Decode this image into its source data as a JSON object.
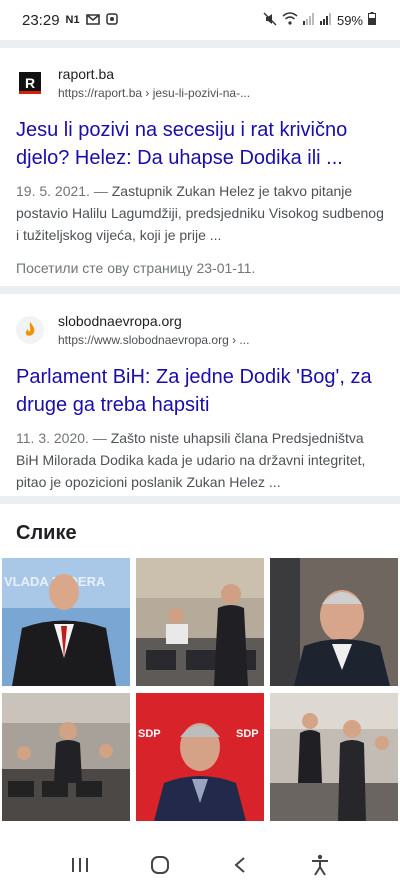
{
  "status_bar": {
    "time": "23:29",
    "left_icons": [
      "N1",
      "gmail-icon",
      "photo-icon"
    ],
    "battery": "59%",
    "right_icons": [
      "mute-icon",
      "wifi-icon",
      "signal-icon",
      "signal-icon",
      "battery-icon"
    ]
  },
  "results": [
    {
      "site_name": "raport.ba",
      "url": "https://raport.ba › jesu-li-pozivi-na-...",
      "title": "Jesu li pozivi na secesiju i rat krivično djelo? Helez: Da uhapse Dodika ili ...",
      "date": "19. 5. 2021. —",
      "snippet": " Zastupnik Zukan Helez je takvo pitanje postavio Halilu Lagumdžiji, predsjedniku Visokog sudbenog i tužiteljskog vijeća, koji je prije ...",
      "visited": "Посетили сте ову страницу 23-01-11.",
      "favicon_letter": "R"
    },
    {
      "site_name": "slobodnaevropa.org",
      "url": "https://www.slobodnaevropa.org › ...",
      "title": "Parlament BiH: Za jedne Dodik 'Bog', za druge ga treba hapsiti",
      "date": "11. 3. 2020. —",
      "snippet": " Zašto niste uhapsili člana Predsjedništva BiH Milorada Dodika kada je udario na državni integritet, pitao je opozicioni poslanik Zukan Helez ...",
      "favicon_icon": "rfe-flame-icon"
    }
  ],
  "images": {
    "heading": "Слике",
    "thumb_texts": [
      "VLADA FEDERA",
      "SDP",
      "SDP"
    ]
  },
  "colors": {
    "link": "#1a0dab",
    "separator": "#eceff1"
  },
  "nav_bar": [
    "recents-icon",
    "home-icon",
    "back-icon",
    "accessibility-icon"
  ]
}
